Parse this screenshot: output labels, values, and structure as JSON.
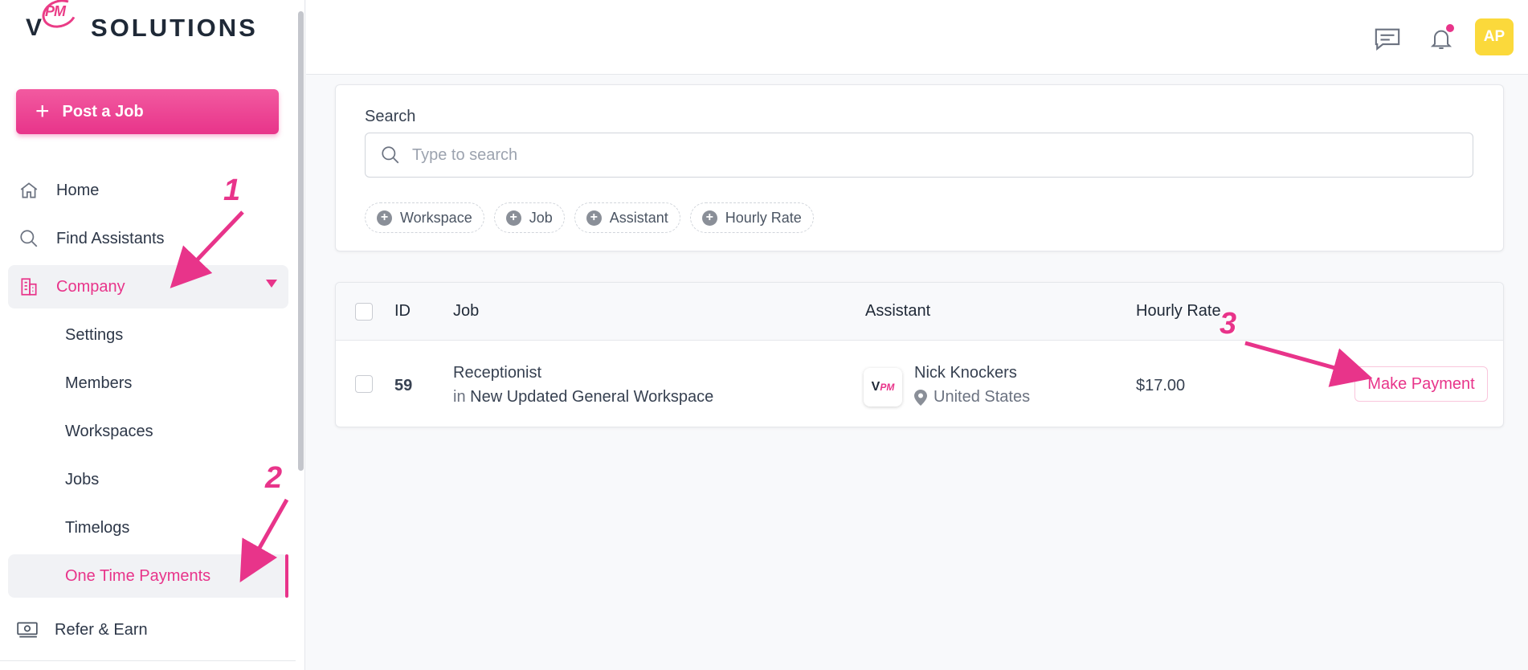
{
  "brand": {
    "logo_mark": "V",
    "logo_pm": "PM",
    "logo_text": "SOLUTIONS",
    "accent_color": "#e8348a"
  },
  "sidebar": {
    "post_job_label": "Post a Job",
    "items": [
      {
        "label": "Home",
        "icon": "home-icon"
      },
      {
        "label": "Find Assistants",
        "icon": "search-icon"
      },
      {
        "label": "Company",
        "icon": "building-icon"
      }
    ],
    "company_sub": [
      {
        "label": "Settings"
      },
      {
        "label": "Members"
      },
      {
        "label": "Workspaces"
      },
      {
        "label": "Jobs"
      },
      {
        "label": "Timelogs"
      },
      {
        "label": "One Time Payments"
      }
    ],
    "refer_label": "Refer & Earn"
  },
  "topbar": {
    "avatar_initials": "AP"
  },
  "search": {
    "label": "Search",
    "placeholder": "Type to search",
    "filters": [
      "Workspace",
      "Job",
      "Assistant",
      "Hourly Rate"
    ]
  },
  "table": {
    "columns": {
      "id": "ID",
      "job": "Job",
      "assistant": "Assistant",
      "hourly_rate": "Hourly Rate"
    },
    "rows": [
      {
        "id": "59",
        "job_title": "Receptionist",
        "job_in": "in",
        "workspace": "New Updated General Workspace",
        "assistant_name": "Nick Knockers",
        "assistant_location": "United States",
        "hourly_rate": "$17.00",
        "action_label": "Make Payment"
      }
    ]
  },
  "annotations": [
    "1",
    "2",
    "3"
  ]
}
